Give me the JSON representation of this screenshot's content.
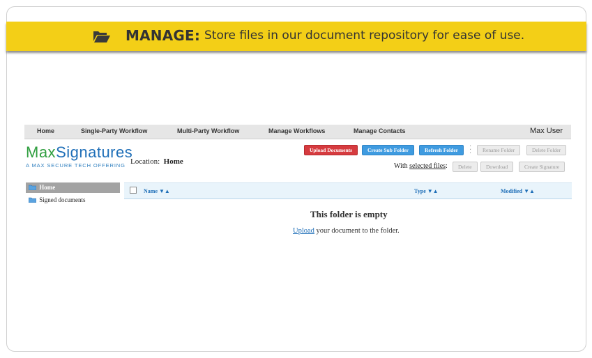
{
  "banner": {
    "title": "MANAGE:",
    "text": "Store files in our document repository for ease of use.",
    "icon": "folder-open-icon"
  },
  "nav": {
    "items": [
      {
        "label": "Home"
      },
      {
        "label": "Single-Party Workflow"
      },
      {
        "label": "Multi-Party Workflow"
      },
      {
        "label": "Manage Workflows"
      },
      {
        "label": "Manage Contacts"
      }
    ],
    "user": "Max User"
  },
  "logo": {
    "part1": "Max",
    "part2": "Signatures",
    "tagline": "A MAX SECURE TECH OFFERING"
  },
  "location": {
    "label": "Location:",
    "value": "Home"
  },
  "toolbar": {
    "upload": "Upload Documents",
    "create_sub": "Create Sub Folder",
    "refresh": "Refresh Folder",
    "rename": "Rename Folder",
    "delete_folder": "Delete Folder",
    "with_prefix": "With",
    "selected_files": "selected files",
    "colon": ":",
    "delete": "Delete",
    "download": "Download",
    "create_signature": "Create Signature"
  },
  "tree": {
    "home": "Home",
    "items": [
      {
        "label": "Signed documents"
      }
    ]
  },
  "table": {
    "columns": [
      {
        "label": "Name",
        "sort": "▼▲"
      },
      {
        "label": "Type",
        "sort": "▼▲"
      },
      {
        "label": "Modified",
        "sort": "▼▲"
      }
    ]
  },
  "empty": {
    "title": "This folder is empty",
    "link": "Upload",
    "text": " your document to the folder."
  },
  "colors": {
    "banner": "#f3cf17",
    "red_button": "#d63b3f",
    "blue_button": "#3f9be0",
    "logo_green": "#2f9e3f",
    "logo_blue": "#1f6fb8"
  }
}
